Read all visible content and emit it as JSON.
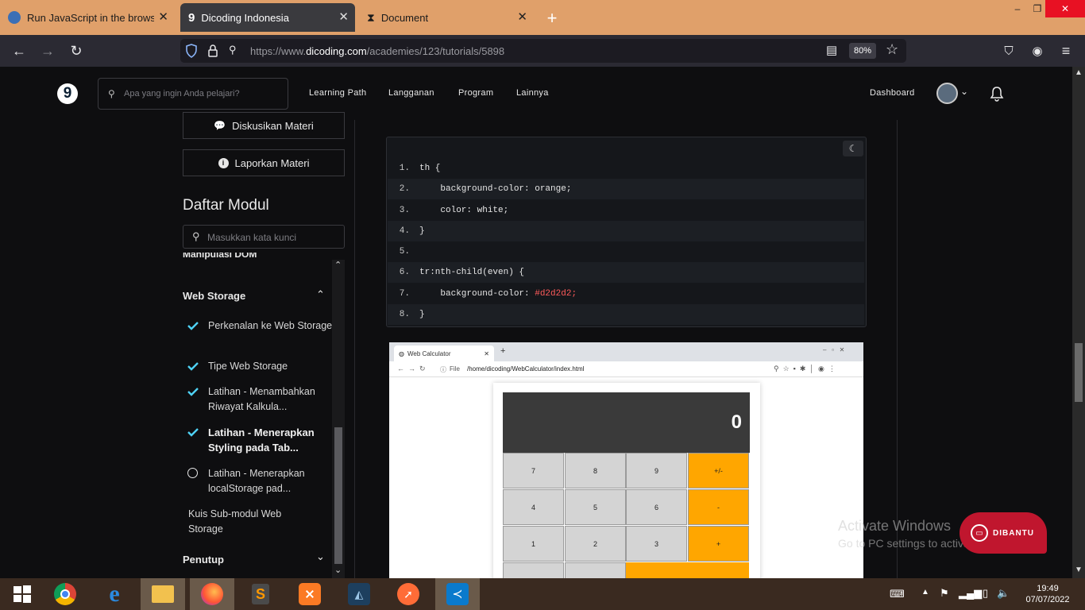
{
  "browser": {
    "tabs": [
      {
        "title": "Run JavaScript in the browser -",
        "icon": "vs-icon"
      },
      {
        "title": "Dicoding Indonesia",
        "icon": "dicoding-logo-icon",
        "active": true
      },
      {
        "title": "Document",
        "icon": "hourglass-icon"
      }
    ],
    "new_tab": "+",
    "window_controls": [
      "–",
      "❐",
      "✕"
    ],
    "url": {
      "prefix": "https://www.",
      "domain": "dicoding.com",
      "path": "/academies/123/tutorials/5898"
    },
    "zoom": "80%"
  },
  "site": {
    "logo": "9",
    "search_placeholder": "Apa yang ingin Anda pelajari?",
    "nav": [
      "Learning Path",
      "Langganan",
      "Program",
      "Lainnya"
    ],
    "dashboard": "Dashboard"
  },
  "sidebar": {
    "discuss_button": "Diskusikan Materi",
    "report_button": "Laporkan Materi",
    "module_heading": "Daftar Modul",
    "module_search_placeholder": "Masukkan kata kunci",
    "prev_section": "Manipulasi DOM",
    "section_web_storage": "Web Storage",
    "items": [
      {
        "label": "Perkenalan ke Web Storage",
        "state": "done"
      },
      {
        "label": "Tipe Web Storage",
        "state": "done"
      },
      {
        "label": "Latihan - Menambahkan Riwayat Kalkula...",
        "state": "done"
      },
      {
        "label": "Latihan - Menerapkan Styling pada Tab...",
        "state": "current"
      },
      {
        "label": "Latihan - Menerapkan localStorage pad...",
        "state": "todo"
      }
    ],
    "quiz": "Kuis Sub-modul Web Storage",
    "section_closing": "Penutup"
  },
  "code": {
    "lines": [
      {
        "n": "1.",
        "text": "th {"
      },
      {
        "n": "2.",
        "text": "    background-color: orange;"
      },
      {
        "n": "3.",
        "text": "    color: white;"
      },
      {
        "n": "4.",
        "text": "}"
      },
      {
        "n": "5.",
        "text": ""
      },
      {
        "n": "6.",
        "text": "tr:nth-child(even) {"
      },
      {
        "n": "7.",
        "prop": "    background-color: ",
        "value": "#d2d2d2;"
      },
      {
        "n": "8.",
        "text": "}"
      }
    ]
  },
  "screenshot": {
    "tab_title": "Web Calculator",
    "address_label": "File",
    "address": "/home/dicoding/WebCalculator/index.html",
    "display": "0",
    "keys": [
      [
        "7",
        "8",
        "9",
        "+/-"
      ],
      [
        "4",
        "5",
        "6",
        "-"
      ],
      [
        "1",
        "2",
        "3",
        "+"
      ]
    ]
  },
  "watermark": {
    "line1": "Activate Windows",
    "line2": "Go to PC settings to activate Windows."
  },
  "help_badge": "DIBANTU",
  "taskbar": {
    "apps": [
      "chrome-icon",
      "ie-icon",
      "file-explorer-icon",
      "firefox-icon",
      "sublime-icon",
      "xampp-icon",
      "mysql-workbench-icon",
      "postman-icon",
      "vscode-icon"
    ],
    "time": "19:49",
    "date": "07/07/2022"
  },
  "colors": {
    "accent": "#4fd2f5",
    "code_value_red": "#ff5b5b",
    "calc_orange": "#ffa600"
  }
}
